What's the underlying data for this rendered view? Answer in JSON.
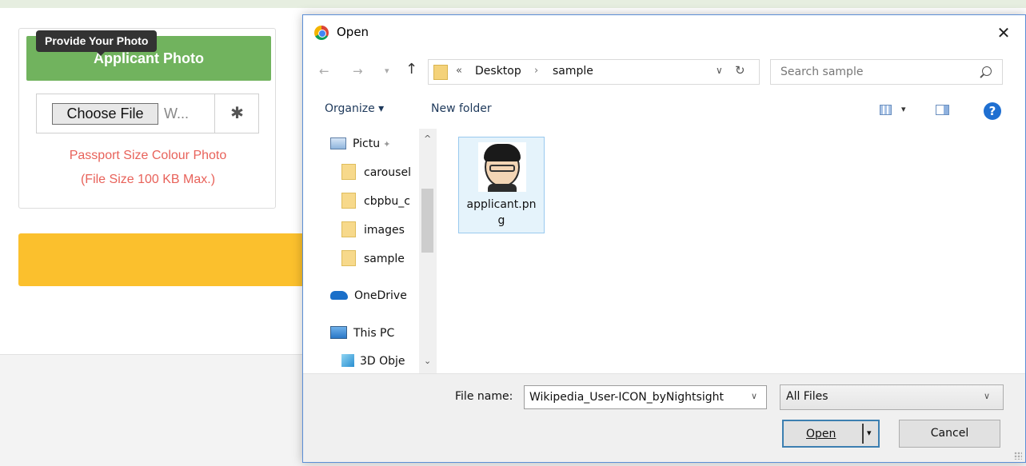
{
  "page": {
    "photo_header": "Applicant Photo",
    "tooltip": "Provide Your Photo",
    "choose_file_label": "Choose File",
    "file_value": "W...",
    "asterisk": "✱",
    "note_line1": "Passport Size Colour Photo",
    "note_line2": "(File Size 100 KB Max.)"
  },
  "dialog": {
    "title": "Open",
    "close_glyph": "✕",
    "nav": {
      "back_glyph": "←",
      "forward_glyph": "→",
      "recent_glyph": "▾",
      "up_glyph": "↑"
    },
    "address": {
      "overflow": "«",
      "parts": [
        "Desktop",
        "sample"
      ],
      "separator": "›",
      "dropdown_glyph": "∨",
      "refresh_glyph": "↻"
    },
    "search": {
      "placeholder": "Search sample"
    },
    "toolbar": {
      "organize": "Organize ▾",
      "new_folder": "New folder",
      "view_dropdown": "▾",
      "help": "?"
    },
    "nav_pane": {
      "items": [
        {
          "label": "Pictu",
          "icon": "pictures-icon",
          "pinned": true
        },
        {
          "label": "carousel",
          "icon": "folder-icon"
        },
        {
          "label": "cbpbu_c",
          "icon": "folder-icon"
        },
        {
          "label": "images",
          "icon": "folder-icon"
        },
        {
          "label": "sample",
          "icon": "folder-icon"
        },
        {
          "label": "OneDrive",
          "icon": "onedrive-icon"
        },
        {
          "label": "This PC",
          "icon": "this-pc-icon"
        },
        {
          "label": "3D Obje",
          "icon": "3d-objects-icon"
        }
      ],
      "pin_glyph": "✦",
      "scroll_up": "^",
      "scroll_down": "⌄"
    },
    "files": [
      {
        "name": "applicant.png",
        "icon": "avatar-thumbnail"
      }
    ],
    "bottom": {
      "file_name_label": "File name:",
      "file_name_value": "Wikipedia_User-ICON_byNightsight",
      "file_name_dd": "∨",
      "file_type": "All Files",
      "file_type_dd": "∨",
      "open_label": "Open",
      "open_dd": "▾",
      "cancel_label": "Cancel"
    }
  },
  "colors": {
    "photo_header_bg": "#71b35e",
    "note_text": "#e8625a",
    "yellow_bar": "#fbc02d",
    "dialog_border": "#5b8ed6",
    "tile_highlight": "#e5f3fb"
  }
}
